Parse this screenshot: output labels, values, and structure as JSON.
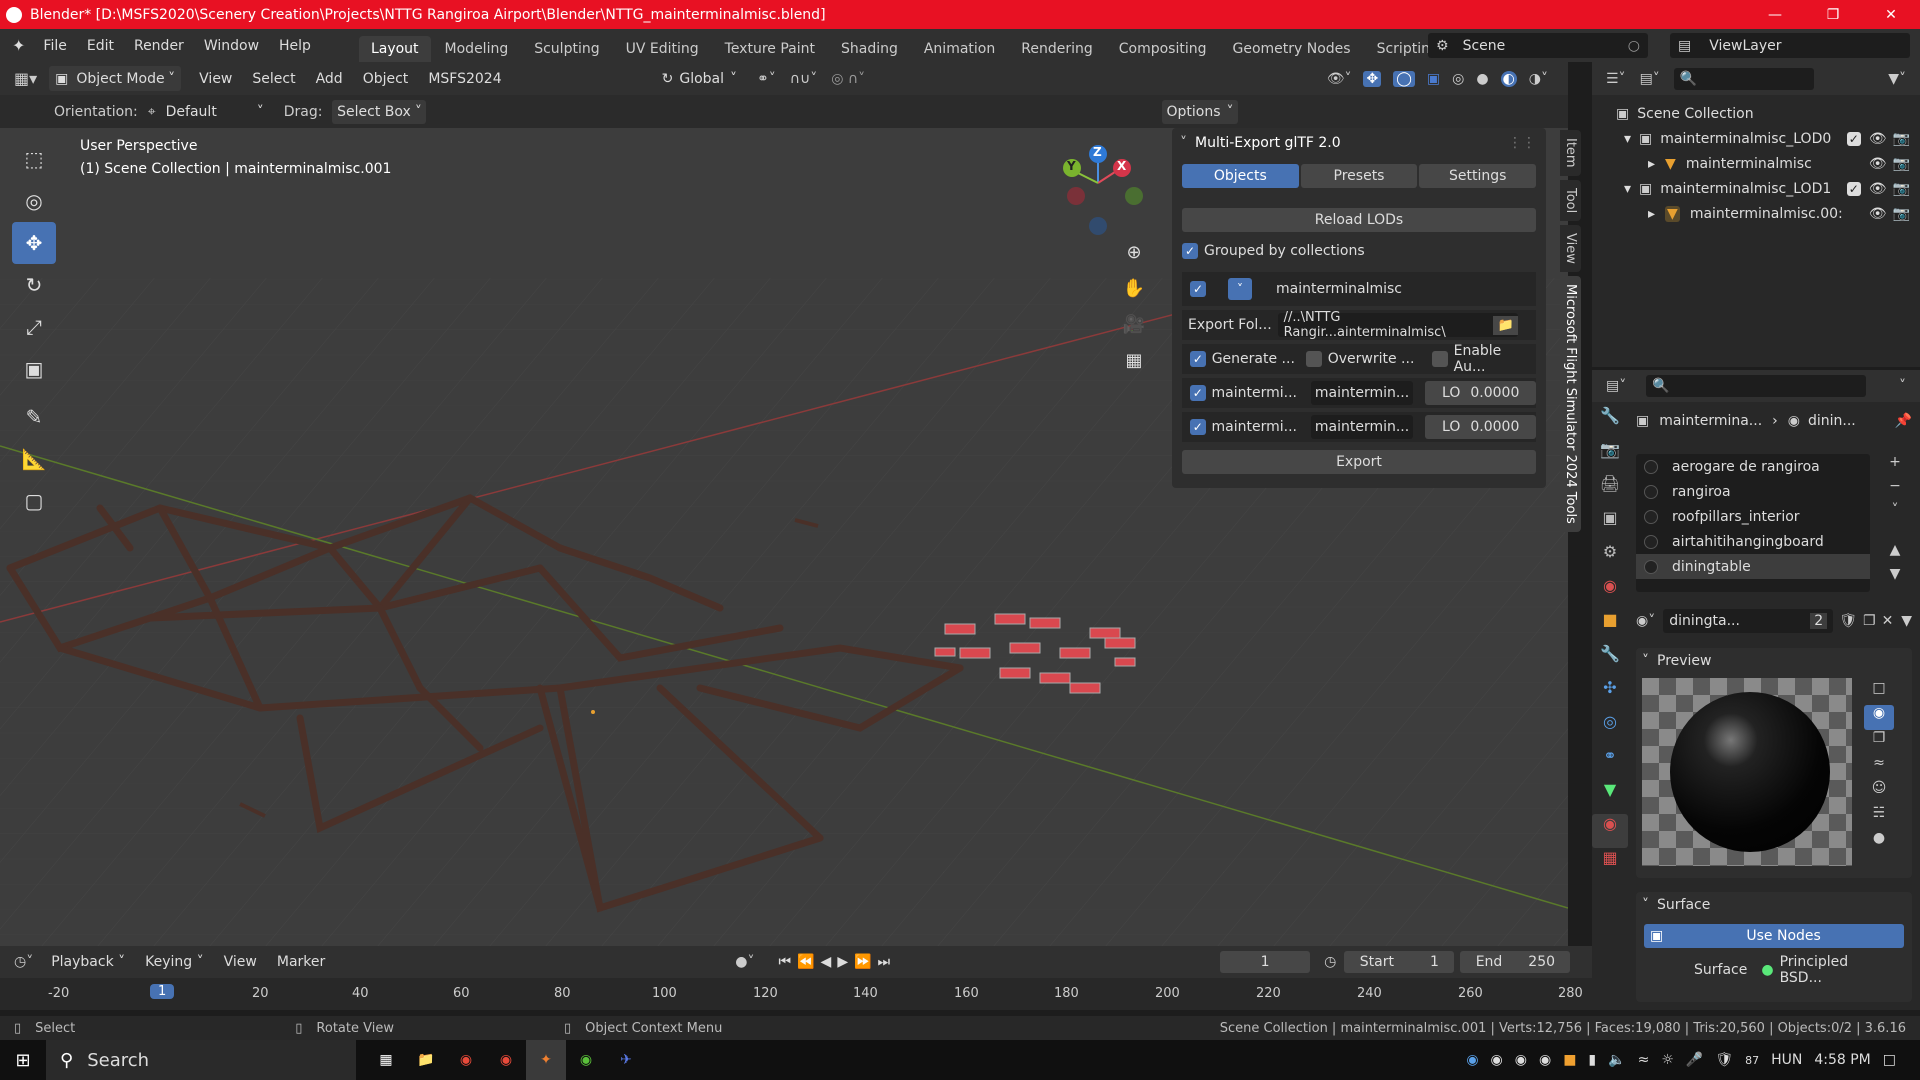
{
  "window": {
    "title": "Blender* [D:\\MSFS2020\\Scenery Creation\\Projects\\NTTG Rangiroa Airport\\Blender\\NTTG_mainterminalmisc.blend]"
  },
  "menus": [
    "File",
    "Edit",
    "Render",
    "Window",
    "Help"
  ],
  "workspaces": [
    "Layout",
    "Modeling",
    "Sculpting",
    "UV Editing",
    "Texture Paint",
    "Shading",
    "Animation",
    "Rendering",
    "Compositing",
    "Geometry Nodes",
    "Scripting"
  ],
  "scene": {
    "label": "Scene",
    "viewlayer": "ViewLayer"
  },
  "viewport_header": {
    "mode": "Object Mode",
    "menus": [
      "View",
      "Select",
      "Add",
      "Object",
      "MSFS2024"
    ],
    "transform": "Global",
    "options": "Options"
  },
  "tool_settings": {
    "orientation_label": "Orientation:",
    "orientation": "Default",
    "drag_label": "Drag:",
    "drag": "Select Box"
  },
  "viewport": {
    "perspective": "User Perspective",
    "collection": "(1) Scene Collection | mainterminalmisc.001"
  },
  "gizmo": {
    "z": "Z",
    "y": "Y",
    "x": "X"
  },
  "side_tabs": [
    "Item",
    "Tool",
    "View",
    "Microsoft Flight Simulator 2024 Tools"
  ],
  "export_panel": {
    "title": "Multi-Export glTF 2.0",
    "tabs": [
      "Objects",
      "Presets",
      "Settings"
    ],
    "reload": "Reload LODs",
    "grouped": "Grouped by collections",
    "group_name": "mainterminalmisc",
    "export_folder_label": "Export Fol...",
    "export_folder_value": "//..\\NTTG Rangir...ainterminalmisc\\",
    "generate": "Generate ...",
    "overwrite": "Overwrite ...",
    "enable_au": "Enable Au...",
    "rows": [
      {
        "name": "maintermi...",
        "file": "maintermin...",
        "lod": "LO",
        "value": "0.0000"
      },
      {
        "name": "maintermi...",
        "file": "maintermin...",
        "lod": "LO",
        "value": "0.0000"
      }
    ],
    "export": "Export"
  },
  "outliner": {
    "root": "Scene Collection",
    "items": [
      {
        "name": "mainterminalmisc_LOD0",
        "level": 1
      },
      {
        "name": "mainterminalmisc",
        "level": 2
      },
      {
        "name": "mainterminalmisc_LOD1",
        "level": 1
      },
      {
        "name": "mainterminalmisc.00:",
        "level": 2
      }
    ]
  },
  "properties": {
    "breadcrumb_obj": "maintermina...",
    "breadcrumb_mat": "dinin...",
    "materials": [
      "aerogare de rangiroa",
      "rangiroa",
      "roofpillars_interior",
      "airtahitihangingboard",
      "diningtable"
    ],
    "selected_material": "diningta...",
    "user_count": "2",
    "preview_label": "Preview",
    "surface_label": "Surface",
    "use_nodes": "Use Nodes",
    "surface_field_label": "Surface",
    "surface_value": "Principled BSD..."
  },
  "timeline": {
    "menus": [
      "Playback",
      "Keying",
      "View",
      "Marker"
    ],
    "current_frame": "1",
    "start_label": "Start",
    "start": "1",
    "end_label": "End",
    "end": "250",
    "ticks": [
      "-20",
      "1",
      "20",
      "40",
      "60",
      "80",
      "100",
      "120",
      "140",
      "160",
      "180",
      "200",
      "220",
      "240",
      "260",
      "280"
    ]
  },
  "statusbar": {
    "select": "Select",
    "rotate": "Rotate View",
    "context": "Object Context Menu",
    "stats": "Scene Collection | mainterminalmisc.001 | Verts:12,756 | Faces:19,080 | Tris:20,560 | Objects:0/2 | 3.6.16"
  },
  "taskbar": {
    "search": "Search",
    "lang": "HUN",
    "time": "4:58 PM",
    "temp": "87"
  },
  "colors": {
    "accent": "#4772b3",
    "titlebar": "#e81123"
  }
}
